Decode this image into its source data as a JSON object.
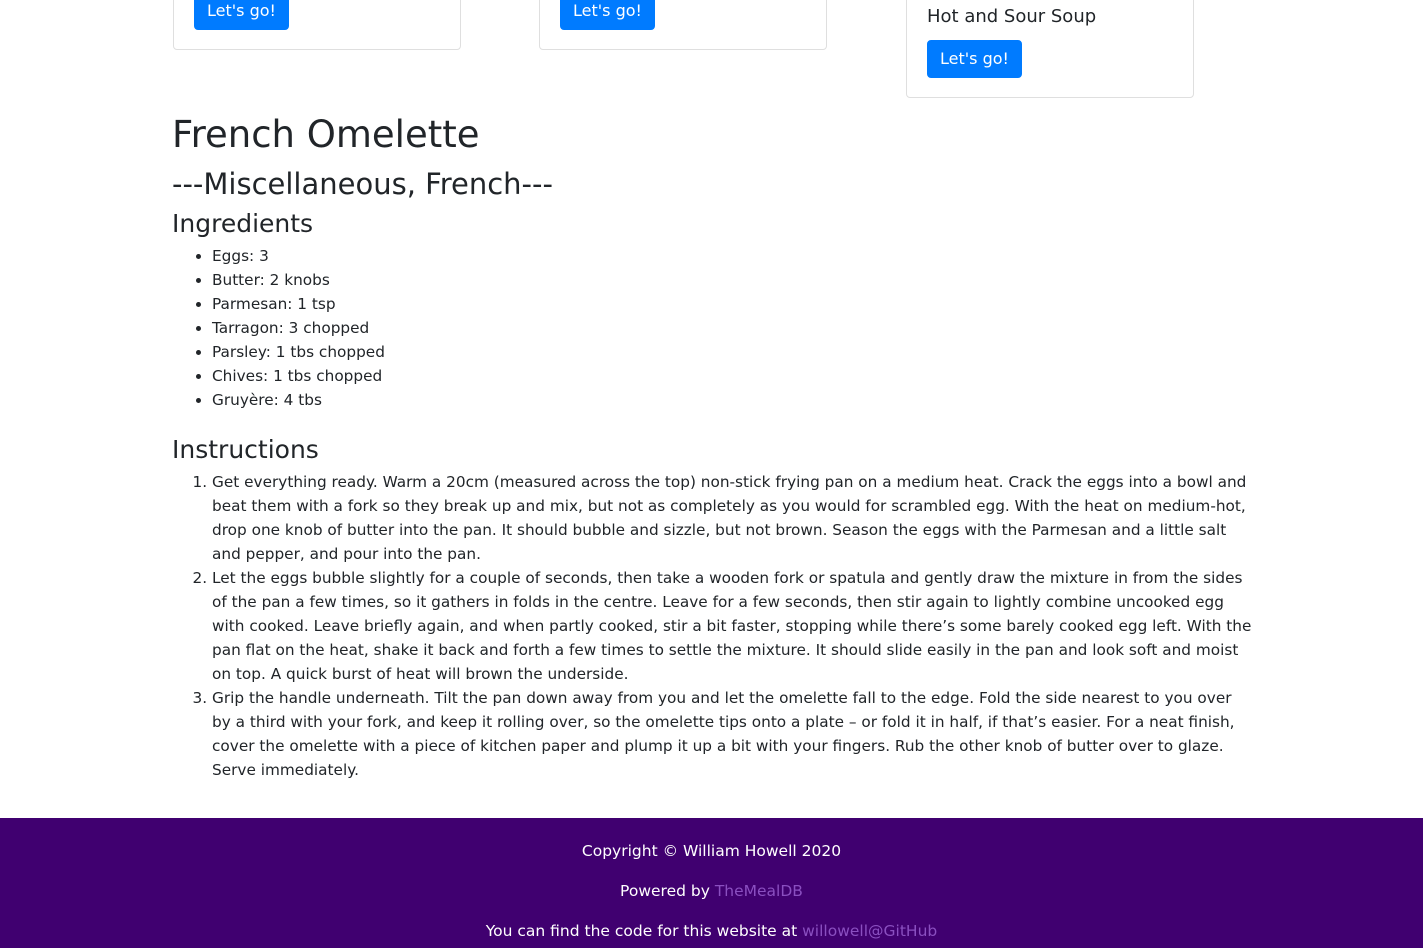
{
  "cards": [
    {
      "title": "",
      "button_label": "Let's go!"
    },
    {
      "title": "",
      "button_label": "Let's go!"
    },
    {
      "title": "Hot and Sour Soup",
      "button_label": "Let's go!"
    }
  ],
  "recipe": {
    "title": "French Omelette",
    "category_line": "---Miscellaneous, French---",
    "ingredients_heading": "Ingredients",
    "ingredients": [
      "Eggs: 3",
      "Butter: 2 knobs",
      "Parmesan: 1 tsp",
      "Tarragon: 3 chopped",
      "Parsley: 1 tbs chopped",
      "Chives: 1 tbs chopped",
      "Gruyère: 4 tbs"
    ],
    "instructions_heading": "Instructions",
    "instructions": [
      "Get everything ready. Warm a 20cm (measured across the top) non-stick frying pan on a medium heat. Crack the eggs into a bowl and beat them with a fork so they break up and mix, but not as completely as you would for scrambled egg. With the heat on medium-hot, drop one knob of butter into the pan. It should bubble and sizzle, but not brown. Season the eggs with the Parmesan and a little salt and pepper, and pour into the pan.",
      "Let the eggs bubble slightly for a couple of seconds, then take a wooden fork or spatula and gently draw the mixture in from the sides of the pan a few times, so it gathers in folds in the centre. Leave for a few seconds, then stir again to lightly combine uncooked egg with cooked. Leave briefly again, and when partly cooked, stir a bit faster, stopping while there’s some barely cooked egg left. With the pan flat on the heat, shake it back and forth a few times to settle the mixture. It should slide easily in the pan and look soft and moist on top. A quick burst of heat will brown the underside.",
      "Grip the handle underneath. Tilt the pan down away from you and let the omelette fall to the edge. Fold the side nearest to you over by a third with your fork, and keep it rolling over, so the omelette tips onto a plate – or fold it in half, if that’s easier. For a neat finish, cover the omelette with a piece of kitchen paper and plump it up a bit with your fingers. Rub the other knob of butter over to glaze. Serve immediately."
    ]
  },
  "footer": {
    "copyright": "Copyright © William Howell 2020",
    "powered_prefix": "Powered by ",
    "powered_link": "TheMealDB",
    "code_prefix": "You can find the code for this website at ",
    "code_link": "willowell@GitHub"
  },
  "colors": {
    "button_bg": "#007bff",
    "footer_bg": "#400070",
    "footer_link": "#8a4fc0"
  }
}
